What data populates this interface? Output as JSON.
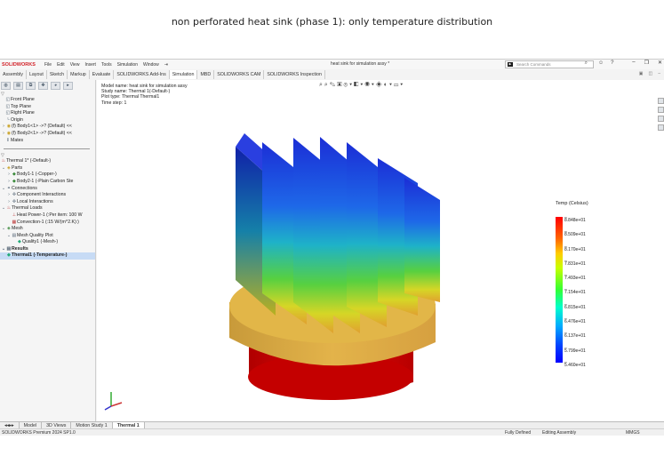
{
  "caption": "non perforated heat sink (phase 1): only temperature distribution",
  "titlebar": {
    "logo": "SOLIDWORKS",
    "menu": [
      "File",
      "Edit",
      "View",
      "Insert",
      "Tools",
      "Simulation",
      "Window"
    ],
    "doc_title": "heat sink for simulation assy *",
    "search_placeholder": "Search Commands"
  },
  "ribbon_tabs": [
    "Assembly",
    "Layout",
    "Sketch",
    "Markup",
    "Evaluate",
    "SOLIDWORKS Add-Ins",
    "Simulation",
    "MBD",
    "SOLIDWORKS CAM",
    "SOLIDWORKS Inspection"
  ],
  "feature_tree": [
    {
      "label": "Front Plane",
      "icon": "plane-icon"
    },
    {
      "label": "Top Plane",
      "icon": "plane-icon"
    },
    {
      "label": "Right Plane",
      "icon": "plane-icon"
    },
    {
      "label": "Origin",
      "icon": "origin-icon"
    },
    {
      "label": "(f) Body1<1> ->? (Default) <<",
      "icon": "part-icon"
    },
    {
      "label": "(f) Body2<1> ->? (Default) <<",
      "icon": "part-icon"
    },
    {
      "label": "Mates",
      "icon": "mates-icon"
    }
  ],
  "sim_tree": [
    {
      "label": "Thermal 1* (-Default-)",
      "level": 0
    },
    {
      "label": "Parts",
      "level": 1
    },
    {
      "label": "Body1-1 (-Copper-)",
      "level": 2
    },
    {
      "label": "Body2-1 (-Plain Carbon Ste",
      "level": 2
    },
    {
      "label": "Connections",
      "level": 1
    },
    {
      "label": "Component Interactions",
      "level": 2
    },
    {
      "label": "Local Interactions",
      "level": 2
    },
    {
      "label": "Thermal Loads",
      "level": 1
    },
    {
      "label": "Heat Power-1 (:Per item: 100 W",
      "level": 2
    },
    {
      "label": "Convection-1 (:15 W/(m^2.K):)",
      "level": 2
    },
    {
      "label": "Mesh",
      "level": 1
    },
    {
      "label": "Mesh Quality Plot",
      "level": 2
    },
    {
      "label": "Quality1 (-Mesh-)",
      "level": 3
    },
    {
      "label": "Results",
      "level": 1
    },
    {
      "label": "Thermal1 (-Temperature-)",
      "level": 2
    }
  ],
  "plot_info": [
    "Model name: heat sink for simulation assy",
    "Study name: Thermal 1(-Default-)",
    "Plot type: Thermal Thermal1",
    "Time step: 1"
  ],
  "legend": {
    "title": "Temp (Celsius)",
    "values": [
      "8.848e+01",
      "8.509e+01",
      "8.170e+01",
      "7.831e+01",
      "7.493e+01",
      "7.154e+01",
      "6.815e+01",
      "6.476e+01",
      "6.137e+01",
      "5.799e+01",
      "5.460e+01"
    ]
  },
  "bottom_tabs": [
    "Model",
    "3D Views",
    "Motion Study 1",
    "Thermal 1"
  ],
  "status": {
    "product": "SOLIDWORKS Premium 2024 SP1.0",
    "defined": "Fully Defined",
    "mode": "Editing Assembly",
    "units": "MMGS"
  },
  "colors": {
    "hot": "#d40000",
    "cold": "#1f2fd6",
    "accent": "#d2232a"
  }
}
